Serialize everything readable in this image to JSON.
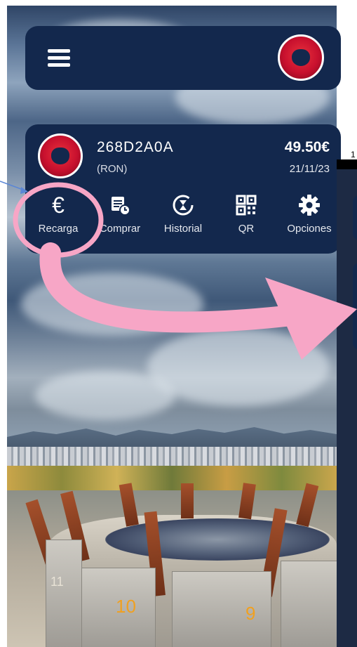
{
  "header": {
    "menu_icon": "hamburger-menu-icon",
    "logo": "club-logo"
  },
  "card": {
    "code": "268D2A0A",
    "subtitle": "(RON)",
    "balance": "49.50€",
    "date": "21/11/23"
  },
  "actions": [
    {
      "label": "Recarga",
      "icon": "euro-icon"
    },
    {
      "label": "Comprar",
      "icon": "calendar-clock-icon"
    },
    {
      "label": "Historial",
      "icon": "hourglass-icon"
    },
    {
      "label": "QR",
      "icon": "qr-code-icon"
    },
    {
      "label": "Opciones",
      "icon": "gear-icon"
    }
  ],
  "background": {
    "building_numbers": [
      "10",
      "9",
      "11"
    ]
  },
  "side_panel": {
    "label": "1"
  },
  "annotation": {
    "highlight_color": "#f7a6c6",
    "pointer_color": "#5a86d6"
  }
}
